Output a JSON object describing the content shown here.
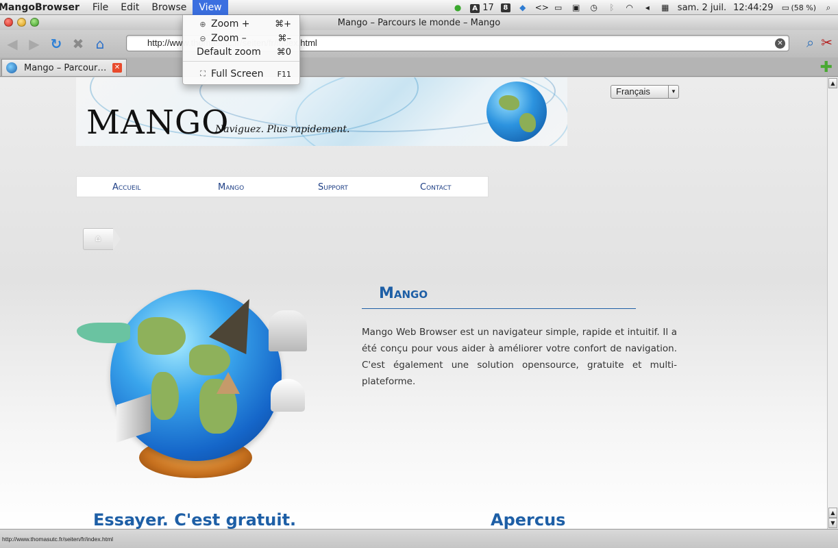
{
  "menubar": {
    "app_name": "MangoBrowser",
    "menus": [
      "File",
      "Edit",
      "Browse",
      "View"
    ],
    "tray": {
      "font_count": "17",
      "date": "sam. 2 juil.",
      "time": "12:44:29",
      "battery": "(58 %)"
    }
  },
  "window": {
    "title": "Mango – Parcours le monde – Mango"
  },
  "toolbar": {
    "url_value": "http://www.thomasutc.fr/seiten/fr/index.html"
  },
  "tabs": [
    {
      "label": "Mango – Parcour…"
    }
  ],
  "view_menu": {
    "items": [
      {
        "label": "Zoom +",
        "shortcut": "⌘+",
        "icon": "zoom-in-icon"
      },
      {
        "label": "Zoom –",
        "shortcut": "⌘–",
        "icon": "zoom-out-icon"
      },
      {
        "label": "Default zoom",
        "shortcut": "⌘0",
        "icon": ""
      },
      {
        "label": "Full Screen",
        "shortcut": "F11",
        "icon": "fullscreen-icon"
      }
    ]
  },
  "page": {
    "logo": "MANGO",
    "tagline": "Naviguez. Plus rapidement.",
    "language": "Français",
    "nav": [
      "Accueil",
      "Mango",
      "Support",
      "Contact"
    ],
    "section_title": "Mango",
    "section_text": "Mango Web Browser est un navigateur simple, rapide et intuitif. Il a été conçu pour vous aider à améliorer votre confort de navigation. C'est également une solution opensource, gratuite et multi-plateforme.",
    "heading_left": "Essayer. C'est gratuit.",
    "heading_right": "Apercus"
  },
  "statusbar": {
    "text": "http://www.thomasutc.fr/seiten/fr/index.html"
  },
  "colors": {
    "accent_blue": "#1e5fa6",
    "nav_text": "#1c3d84",
    "menu_highlight": "#3b6fe0",
    "tab_close": "#e84a2c"
  }
}
